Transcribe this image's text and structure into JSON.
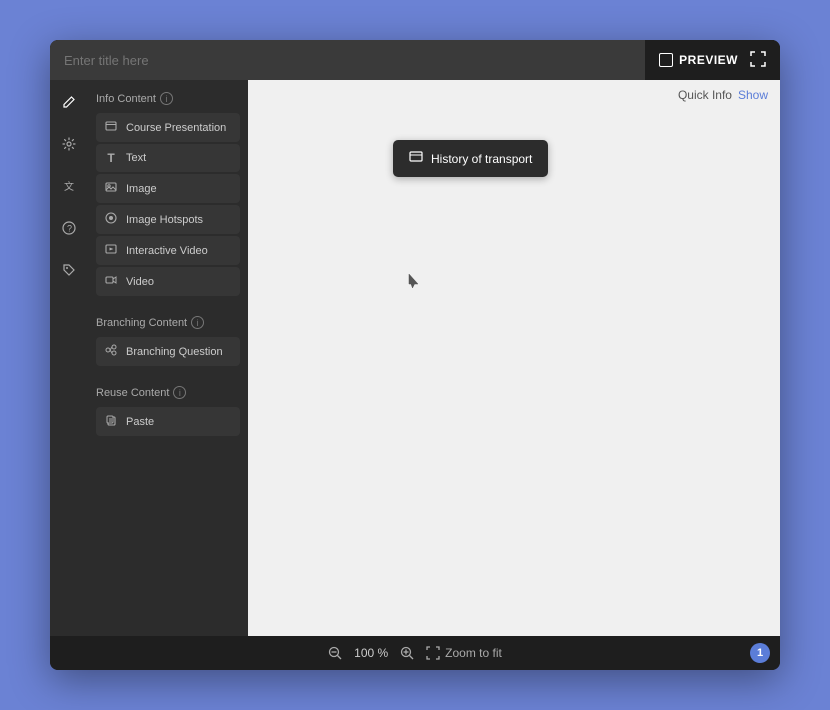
{
  "topbar": {
    "title_placeholder": "Enter title here",
    "preview_label": "PREVIEW",
    "fullscreen_label": "⛶"
  },
  "icon_sidebar": {
    "icons": [
      {
        "name": "edit-icon",
        "symbol": "✏",
        "active": true
      },
      {
        "name": "settings-icon",
        "symbol": "⚙"
      },
      {
        "name": "translate-icon",
        "symbol": "⌨"
      },
      {
        "name": "help-icon",
        "symbol": "?"
      },
      {
        "name": "tag-icon",
        "symbol": "🏷"
      }
    ]
  },
  "panel_sidebar": {
    "sections": [
      {
        "title": "Info Content",
        "has_info": true,
        "items": [
          {
            "icon": "🖥",
            "label": "Course Presentation"
          },
          {
            "icon": "T",
            "label": "Text"
          },
          {
            "icon": "🖼",
            "label": "Image"
          },
          {
            "icon": "📍",
            "label": "Image Hotspots"
          },
          {
            "icon": "▶",
            "label": "Interactive Video"
          },
          {
            "icon": "🎬",
            "label": "Video"
          }
        ]
      },
      {
        "title": "Branching Content",
        "has_info": true,
        "items": [
          {
            "icon": "↗",
            "label": "Branching Question"
          }
        ]
      },
      {
        "title": "Reuse Content",
        "has_info": true,
        "items": [
          {
            "icon": "📋",
            "label": "Paste"
          }
        ]
      }
    ]
  },
  "canvas": {
    "node_label": "History of transport",
    "node_icon": "🖥"
  },
  "quick_info": {
    "label": "Quick Info",
    "action": "Show"
  },
  "bottom_bar": {
    "zoom_out_label": "−",
    "zoom_level": "100 %",
    "zoom_in_label": "+",
    "zoom_fit_label": "Zoom to fit",
    "badge_count": "1"
  }
}
